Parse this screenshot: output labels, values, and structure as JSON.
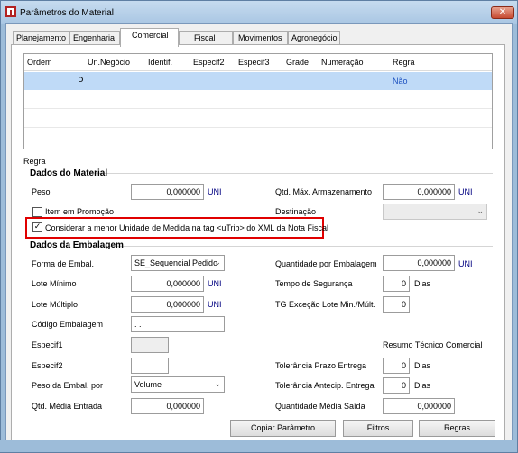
{
  "window": {
    "title": "Parâmetros do Material",
    "close_glyph": "✕"
  },
  "tabs": [
    {
      "label": "Planejamento"
    },
    {
      "label": "Engenharia"
    },
    {
      "label": "Comercial"
    },
    {
      "label": "Fiscal"
    },
    {
      "label": "Movimentos"
    },
    {
      "label": "Agronegócio"
    }
  ],
  "grid": {
    "columns": [
      "Ordem",
      "Un.Negócio",
      "Identif.",
      "Especif2",
      "Especif3",
      "Grade",
      "Numeração",
      "Regra"
    ],
    "rows": [
      {
        "ordem": "",
        "un_negocio": "",
        "regra": "Não"
      }
    ]
  },
  "regra_label": "Regra",
  "dados_material": {
    "heading": "Dados do Material",
    "peso_label": "Peso",
    "peso_value": "0,000000",
    "peso_unit": "UNI",
    "qtd_max_label": "Qtd. Máx. Armazenamento",
    "qtd_max_value": "0,000000",
    "qtd_max_unit": "UNI",
    "item_promocao_label": "Item em Promoção",
    "destinacao_label": "Destinação",
    "destinacao_value": "",
    "considerar_label": "Considerar a menor Unidade de Medida na tag <uTrib> do XML da Nota Fiscal",
    "considerar_checked": true
  },
  "dados_embalagem": {
    "heading": "Dados da Embalagem",
    "forma_label": "Forma de Embal.",
    "forma_value": "SE_Sequencial Pedido",
    "qtd_embalagem_label": "Quantidade por Embalagem",
    "qtd_embalagem_value": "0,000000",
    "qtd_embalagem_unit": "UNI",
    "lote_minimo_label": "Lote Mínimo",
    "lote_minimo_value": "0,000000",
    "lote_minimo_unit": "UNI",
    "tempo_seguranca_label": "Tempo de Segurança",
    "tempo_seguranca_value": "0",
    "tempo_seguranca_unit": "Dias",
    "lote_multiplo_label": "Lote Múltiplo",
    "lote_multiplo_value": "0,000000",
    "lote_multiplo_unit": "UNI",
    "tg_excecao_label": "TG Exceção Lote Min./Múlt.",
    "tg_excecao_value": "0",
    "codigo_label": "Código Embalagem",
    "codigo_value": ". .",
    "especif1_label": "Especif1",
    "resumo_link": "Resumo Técnico Comercial",
    "especif2_label": "Especif2",
    "tolerancia_prazo_label": "Tolerância Prazo Entrega",
    "tolerancia_prazo_value": "0",
    "tolerancia_prazo_unit": "Dias",
    "peso_embal_label": "Peso da Embal. por",
    "peso_embal_value": "Volume",
    "tolerancia_antecip_label": "Tolerância Antecip. Entrega",
    "tolerancia_antecip_value": "0",
    "tolerancia_antecip_unit": "Dias",
    "qtd_media_entrada_label": "Qtd. Média Entrada",
    "qtd_media_entrada_value": "0,000000",
    "qtd_media_saida_label": "Quantidade Média Saída",
    "qtd_media_saida_value": "0,000000"
  },
  "buttons": {
    "copiar": "Copiar Parâmetro",
    "filtros": "Filtros",
    "regras": "Regras"
  }
}
